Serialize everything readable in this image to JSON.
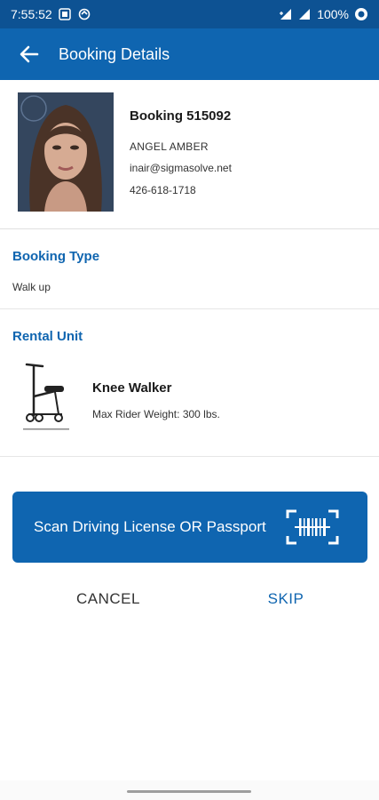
{
  "status_bar": {
    "time": "7:55:52",
    "battery": "100%",
    "icons": [
      "app-notification-icon",
      "sync-icon",
      "wifi-data-icon",
      "signal-icon",
      "battery-icon"
    ]
  },
  "app_bar": {
    "title": "Booking Details",
    "back_icon": "arrow-left-icon"
  },
  "booking": {
    "number": "Booking 515092",
    "customer_name": "ANGEL AMBER",
    "email": "inair@sigmasolve.net",
    "phone": "426-618-1718"
  },
  "booking_type": {
    "title": "Booking Type",
    "value": "Walk up"
  },
  "rental_unit": {
    "title": "Rental Unit",
    "name": "Knee Walker",
    "spec": "Max Rider Weight: 300 lbs."
  },
  "actions": {
    "scan_label": "Scan Driving License OR Passport",
    "scan_icon": "barcode-scan-icon",
    "cancel_label": "CANCEL",
    "skip_label": "SKIP"
  },
  "colors": {
    "status_bar": "#0d5293",
    "primary": "#0f65b0",
    "text": "#1a1a1a"
  }
}
